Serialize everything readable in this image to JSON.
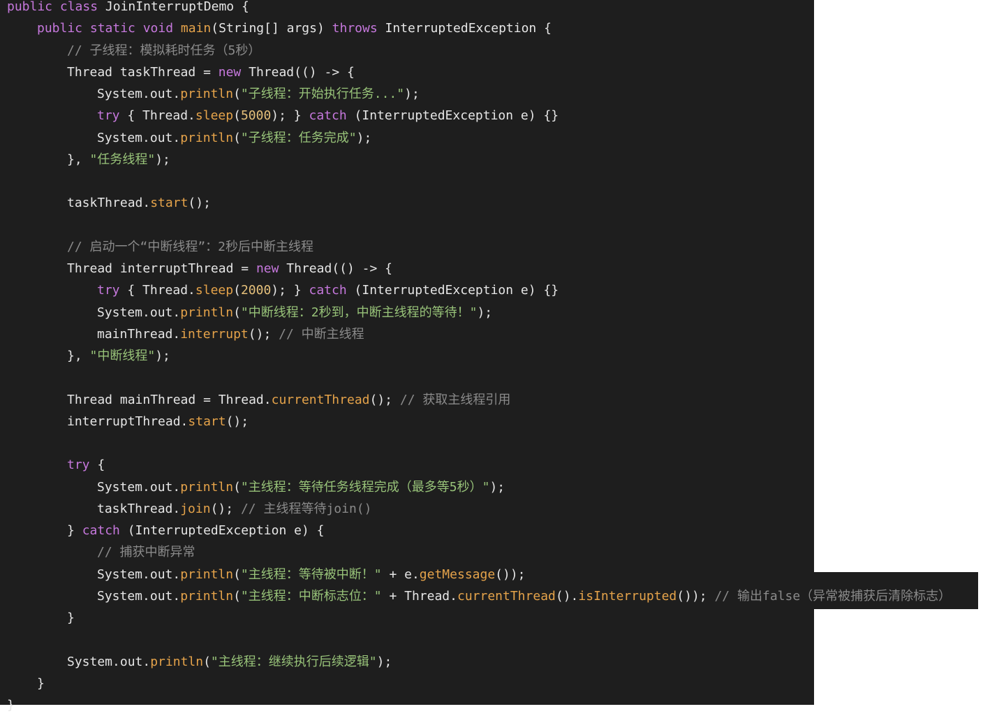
{
  "editor": {
    "lines": [
      {
        "indent": 0,
        "tokens": [
          {
            "t": "kw",
            "v": "public class "
          },
          {
            "t": "plain",
            "v": "JoinInterruptDemo {"
          }
        ]
      },
      {
        "indent": 1,
        "tokens": [
          {
            "t": "kw",
            "v": "public static void "
          },
          {
            "t": "fn",
            "v": "main"
          },
          {
            "t": "plain",
            "v": "(String[] args) "
          },
          {
            "t": "kw",
            "v": "throws "
          },
          {
            "t": "plain",
            "v": "InterruptedException {"
          }
        ]
      },
      {
        "indent": 2,
        "tokens": [
          {
            "t": "cm",
            "v": "// 子线程：模拟耗时任务（5秒）"
          }
        ]
      },
      {
        "indent": 2,
        "tokens": [
          {
            "t": "plain",
            "v": "Thread taskThread = "
          },
          {
            "t": "kw",
            "v": "new "
          },
          {
            "t": "plain",
            "v": "Thread(() -> {"
          }
        ]
      },
      {
        "indent": 3,
        "tokens": [
          {
            "t": "plain",
            "v": "System.out."
          },
          {
            "t": "fn",
            "v": "println"
          },
          {
            "t": "plain",
            "v": "("
          },
          {
            "t": "str",
            "v": "\"子线程：开始执行任务...\""
          },
          {
            "t": "plain",
            "v": ");"
          }
        ]
      },
      {
        "indent": 3,
        "tokens": [
          {
            "t": "kw",
            "v": "try "
          },
          {
            "t": "plain",
            "v": "{ Thread."
          },
          {
            "t": "fn",
            "v": "sleep"
          },
          {
            "t": "plain",
            "v": "("
          },
          {
            "t": "num",
            "v": "5000"
          },
          {
            "t": "plain",
            "v": "); } "
          },
          {
            "t": "kw",
            "v": "catch "
          },
          {
            "t": "plain",
            "v": "(InterruptedException e) {}"
          }
        ]
      },
      {
        "indent": 3,
        "tokens": [
          {
            "t": "plain",
            "v": "System.out."
          },
          {
            "t": "fn",
            "v": "println"
          },
          {
            "t": "plain",
            "v": "("
          },
          {
            "t": "str",
            "v": "\"子线程：任务完成\""
          },
          {
            "t": "plain",
            "v": ");"
          }
        ]
      },
      {
        "indent": 2,
        "tokens": [
          {
            "t": "plain",
            "v": "}, "
          },
          {
            "t": "str",
            "v": "\"任务线程\""
          },
          {
            "t": "plain",
            "v": ");"
          }
        ]
      },
      {
        "indent": 0,
        "tokens": []
      },
      {
        "indent": 2,
        "tokens": [
          {
            "t": "plain",
            "v": "taskThread."
          },
          {
            "t": "fn",
            "v": "start"
          },
          {
            "t": "plain",
            "v": "();"
          }
        ]
      },
      {
        "indent": 0,
        "tokens": []
      },
      {
        "indent": 2,
        "tokens": [
          {
            "t": "cm",
            "v": "// 启动一个“中断线程”：2秒后中断主线程"
          }
        ]
      },
      {
        "indent": 2,
        "tokens": [
          {
            "t": "plain",
            "v": "Thread interruptThread = "
          },
          {
            "t": "kw",
            "v": "new "
          },
          {
            "t": "plain",
            "v": "Thread(() -> {"
          }
        ]
      },
      {
        "indent": 3,
        "tokens": [
          {
            "t": "kw",
            "v": "try "
          },
          {
            "t": "plain",
            "v": "{ Thread."
          },
          {
            "t": "fn",
            "v": "sleep"
          },
          {
            "t": "plain",
            "v": "("
          },
          {
            "t": "num",
            "v": "2000"
          },
          {
            "t": "plain",
            "v": "); } "
          },
          {
            "t": "kw",
            "v": "catch "
          },
          {
            "t": "plain",
            "v": "(InterruptedException e) {}"
          }
        ]
      },
      {
        "indent": 3,
        "tokens": [
          {
            "t": "plain",
            "v": "System.out."
          },
          {
            "t": "fn",
            "v": "println"
          },
          {
            "t": "plain",
            "v": "("
          },
          {
            "t": "str",
            "v": "\"中断线程：2秒到，中断主线程的等待！\""
          },
          {
            "t": "plain",
            "v": ");"
          }
        ]
      },
      {
        "indent": 3,
        "tokens": [
          {
            "t": "plain",
            "v": "mainThread."
          },
          {
            "t": "fn",
            "v": "interrupt"
          },
          {
            "t": "plain",
            "v": "(); "
          },
          {
            "t": "cm",
            "v": "// 中断主线程"
          }
        ]
      },
      {
        "indent": 2,
        "tokens": [
          {
            "t": "plain",
            "v": "}, "
          },
          {
            "t": "str",
            "v": "\"中断线程\""
          },
          {
            "t": "plain",
            "v": ");"
          }
        ]
      },
      {
        "indent": 0,
        "tokens": []
      },
      {
        "indent": 2,
        "tokens": [
          {
            "t": "plain",
            "v": "Thread mainThread = Thread."
          },
          {
            "t": "fn",
            "v": "currentThread"
          },
          {
            "t": "plain",
            "v": "(); "
          },
          {
            "t": "cm",
            "v": "// 获取主线程引用"
          }
        ]
      },
      {
        "indent": 2,
        "tokens": [
          {
            "t": "plain",
            "v": "interruptThread."
          },
          {
            "t": "fn",
            "v": "start"
          },
          {
            "t": "plain",
            "v": "();"
          }
        ]
      },
      {
        "indent": 0,
        "tokens": []
      },
      {
        "indent": 2,
        "tokens": [
          {
            "t": "kw",
            "v": "try "
          },
          {
            "t": "plain",
            "v": "{"
          }
        ]
      },
      {
        "indent": 3,
        "tokens": [
          {
            "t": "plain",
            "v": "System.out."
          },
          {
            "t": "fn",
            "v": "println"
          },
          {
            "t": "plain",
            "v": "("
          },
          {
            "t": "str",
            "v": "\"主线程：等待任务线程完成（最多等5秒）\""
          },
          {
            "t": "plain",
            "v": ");"
          }
        ]
      },
      {
        "indent": 3,
        "tokens": [
          {
            "t": "plain",
            "v": "taskThread."
          },
          {
            "t": "fn",
            "v": "join"
          },
          {
            "t": "plain",
            "v": "(); "
          },
          {
            "t": "cm",
            "v": "// 主线程等待join()"
          }
        ]
      },
      {
        "indent": 2,
        "tokens": [
          {
            "t": "plain",
            "v": "} "
          },
          {
            "t": "kw",
            "v": "catch "
          },
          {
            "t": "plain",
            "v": "(InterruptedException e) {"
          }
        ]
      },
      {
        "indent": 3,
        "tokens": [
          {
            "t": "cm",
            "v": "// 捕获中断异常"
          }
        ]
      },
      {
        "indent": 3,
        "tokens": [
          {
            "t": "plain",
            "v": "System.out."
          },
          {
            "t": "fn",
            "v": "println"
          },
          {
            "t": "plain",
            "v": "("
          },
          {
            "t": "str",
            "v": "\"主线程：等待被中断！\""
          },
          {
            "t": "plain",
            "v": " + e."
          },
          {
            "t": "fn",
            "v": "getMessage"
          },
          {
            "t": "plain",
            "v": "());"
          }
        ]
      },
      {
        "indent": 3,
        "tokens": [
          {
            "t": "plain",
            "v": "System.out."
          },
          {
            "t": "fn",
            "v": "println"
          },
          {
            "t": "plain",
            "v": "("
          },
          {
            "t": "str",
            "v": "\"主线程：中断标志位：\""
          },
          {
            "t": "plain",
            "v": " + Thread."
          },
          {
            "t": "fn",
            "v": "currentThread"
          },
          {
            "t": "plain",
            "v": "()."
          },
          {
            "t": "fn",
            "v": "isInterrupted"
          },
          {
            "t": "plain",
            "v": "()); "
          },
          {
            "t": "cm",
            "v": "// 输出false（异常被捕获后清除标志）"
          }
        ]
      },
      {
        "indent": 2,
        "tokens": [
          {
            "t": "plain",
            "v": "}"
          }
        ]
      },
      {
        "indent": 0,
        "tokens": []
      },
      {
        "indent": 2,
        "tokens": [
          {
            "t": "plain",
            "v": "System.out."
          },
          {
            "t": "fn",
            "v": "println"
          },
          {
            "t": "plain",
            "v": "("
          },
          {
            "t": "str",
            "v": "\"主线程：继续执行后续逻辑\""
          },
          {
            "t": "plain",
            "v": ");"
          }
        ]
      },
      {
        "indent": 1,
        "tokens": [
          {
            "t": "plain",
            "v": "}"
          }
        ]
      },
      {
        "indent": 0,
        "tokens": [
          {
            "t": "plain",
            "v": "}"
          }
        ]
      }
    ]
  },
  "colors": {
    "background": "#1e1e1e",
    "keyword": "#c678dd",
    "method": "#e5a34a",
    "string": "#98c379",
    "number": "#e5c07b",
    "comment": "#8b8b8b",
    "text": "#e6e6e6"
  }
}
